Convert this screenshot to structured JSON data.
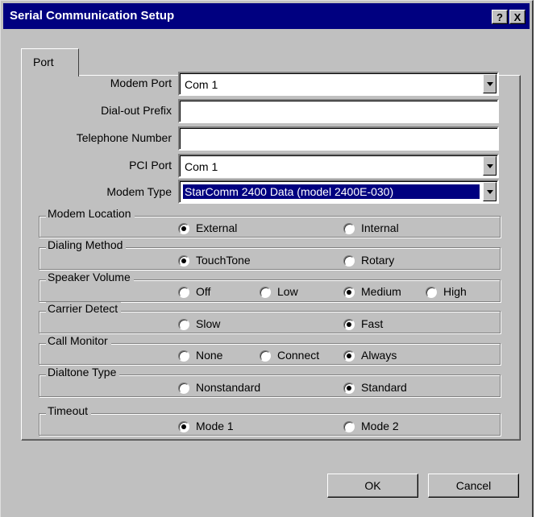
{
  "window": {
    "title": "Serial Communication Setup",
    "help_label": "?",
    "close_label": "X"
  },
  "tabs": [
    {
      "label": "Port"
    }
  ],
  "fields": {
    "modem_port": {
      "label": "Modem Port",
      "value": "Com 1"
    },
    "dial_out_prefix": {
      "label": "Dial-out Prefix",
      "value": ""
    },
    "telephone_number": {
      "label": "Telephone Number",
      "value": ""
    },
    "pci_port": {
      "label": "PCI Port",
      "value": "Com 1"
    },
    "modem_type": {
      "label": "Modem Type",
      "value": "StarComm 2400 Data (model 2400E-030)"
    }
  },
  "groups": {
    "modem_location": {
      "label": "Modem Location",
      "options": [
        "External",
        "Internal"
      ],
      "selected": "External"
    },
    "dialing_method": {
      "label": "Dialing Method",
      "options": [
        "TouchTone",
        "Rotary"
      ],
      "selected": "TouchTone"
    },
    "speaker_volume": {
      "label": "Speaker Volume",
      "options": [
        "Off",
        "Low",
        "Medium",
        "High"
      ],
      "selected": "Medium"
    },
    "carrier_detect": {
      "label": "Carrier Detect",
      "options": [
        "Slow",
        "Fast"
      ],
      "selected": "Fast"
    },
    "call_monitor": {
      "label": "Call Monitor",
      "options": [
        "None",
        "Connect",
        "Always"
      ],
      "selected": "Always"
    },
    "dialtone_type": {
      "label": "Dialtone Type",
      "options": [
        "Nonstandard",
        "Standard"
      ],
      "selected": "Standard"
    },
    "timeout": {
      "label": "Timeout",
      "options": [
        "Mode 1",
        "Mode 2"
      ],
      "selected": "Mode 1"
    }
  },
  "buttons": {
    "ok": "OK",
    "cancel": "Cancel"
  },
  "colors": {
    "titlebar": "#000080",
    "face": "#c0c0c0",
    "selection": "#000080"
  }
}
